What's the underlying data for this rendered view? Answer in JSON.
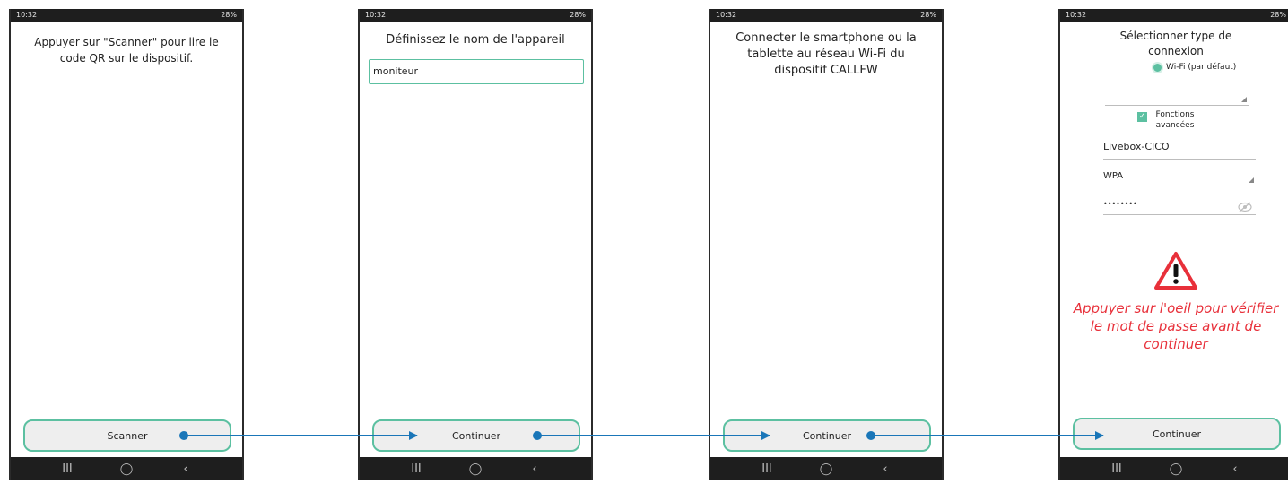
{
  "status_bar": {
    "time": "10:32",
    "icons_text": "28%"
  },
  "nav_icons": [
    "recents-icon",
    "home-icon",
    "back-icon"
  ],
  "nav_glyphs": [
    "III",
    "◯",
    "‹"
  ],
  "screen1": {
    "instruction": "Appuyer sur \"Scanner\" pour lire le code QR sur le dispositif.",
    "button_label": "Scanner"
  },
  "screen2": {
    "title": "Définissez le nom de l'appareil",
    "device_name_value": "moniteur",
    "button_label": "Continuer"
  },
  "screen3": {
    "instruction": "Connecter le smartphone ou la tablette au réseau Wi-Fi du dispositif CALLFW",
    "button_label": "Continuer"
  },
  "screen4": {
    "title": "Sélectionner type de connexion",
    "radio_label": "Wi-Fi (par défaut)",
    "checkbox_label": "Fonctions avancées",
    "ssid_value": "Livebox-CICO",
    "security_value": "WPA",
    "password_mask": "••••••••",
    "warning_text": "Appuyer sur l'oeil pour vérifier le mot de passe avant de continuer",
    "button_label": "Continuer"
  },
  "colors": {
    "accent": "#5cc0a1",
    "connector": "#1a76b8",
    "warning": "#e8303a",
    "button_bg": "#eeeeee",
    "bars": "#1e1e1e"
  }
}
